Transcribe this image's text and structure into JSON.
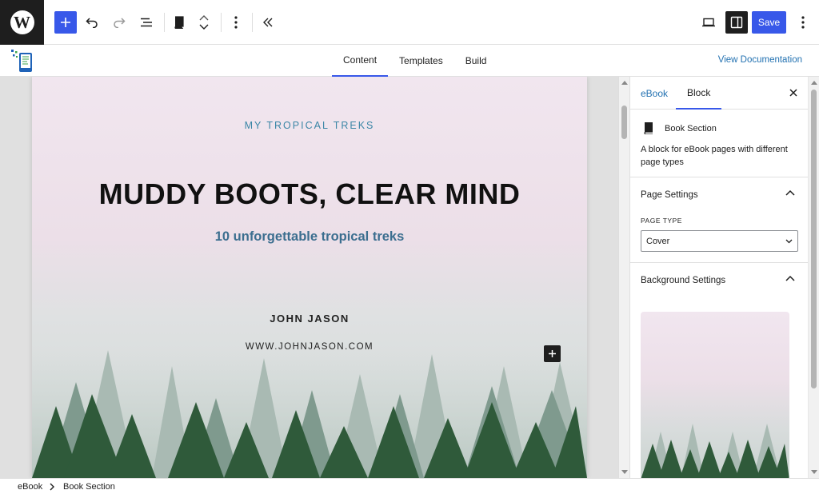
{
  "toolbar": {
    "logo_letter": "W",
    "save_label": "Save"
  },
  "nav": {
    "tabs": [
      {
        "label": "Content",
        "active": true
      },
      {
        "label": "Templates",
        "active": false
      },
      {
        "label": "Build",
        "active": false
      }
    ],
    "view_documentation": "View Documentation"
  },
  "cover": {
    "kicker": "MY TROPICAL TREKS",
    "title": "MUDDY BOOTS, CLEAR MIND",
    "subtitle": "10 unforgettable tropical treks",
    "author": "JOHN JASON",
    "website": "WWW.JOHNJASON.COM"
  },
  "sidebar": {
    "tabs": {
      "ebook": "eBook",
      "block": "Block"
    },
    "block_name": "Book Section",
    "block_description": "A block for eBook pages with different page types",
    "page_settings_title": "Page Settings",
    "page_type_label": "PAGE TYPE",
    "page_type_value": "Cover",
    "background_settings_title": "Background Settings"
  },
  "breadcrumbs": [
    "eBook",
    "Book Section"
  ],
  "colors": {
    "accent": "#3858e9",
    "link": "#2271b1",
    "kicker": "#3b86a6",
    "subtitle": "#3b6e8f"
  }
}
